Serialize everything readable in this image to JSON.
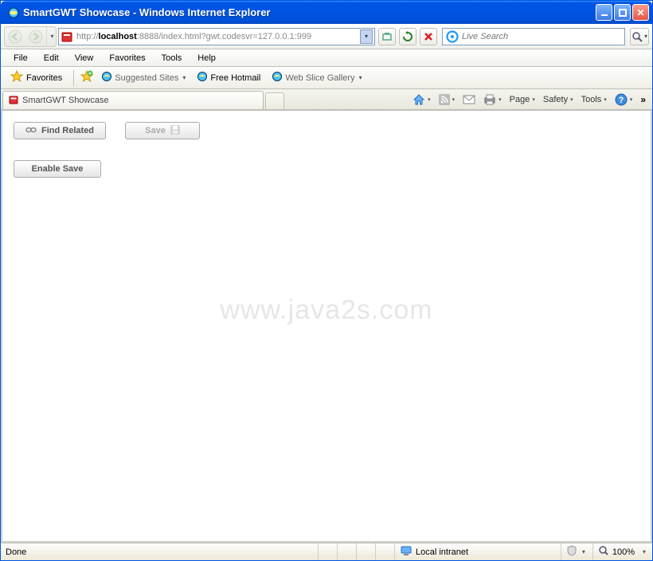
{
  "window": {
    "title": "SmartGWT Showcase - Windows Internet Explorer"
  },
  "nav": {
    "url_prefix": "http://",
    "url_host": "localhost",
    "url_rest": ":8888/index.html?gwt.codesvr=127.0.0.1:999",
    "search_placeholder": "Live Search"
  },
  "menu": {
    "file": "File",
    "edit": "Edit",
    "view": "View",
    "favorites": "Favorites",
    "tools": "Tools",
    "help": "Help"
  },
  "favbar": {
    "favorites": "Favorites",
    "suggested": "Suggested Sites",
    "hotmail": "Free Hotmail",
    "webslice": "Web Slice Gallery"
  },
  "tabs": {
    "active": "SmartGWT Showcase"
  },
  "tabtools": {
    "page": "Page",
    "safety": "Safety",
    "tools": "Tools"
  },
  "content": {
    "find_related": "Find Related",
    "save": "Save",
    "enable_save": "Enable Save",
    "watermark": "www.java2s.com"
  },
  "status": {
    "done": "Done",
    "zone": "Local intranet",
    "zoom": "100%"
  }
}
